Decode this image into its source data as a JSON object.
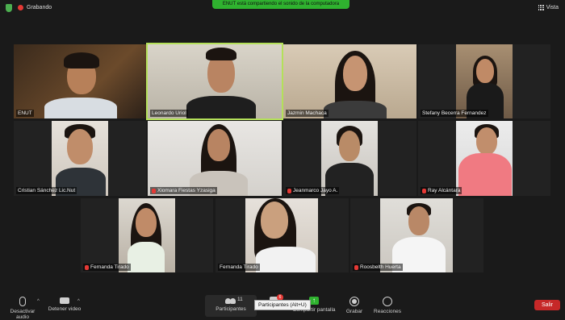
{
  "top": {
    "recording_label": "Grabando",
    "share_banner": "ENUT está compartiendo el sonido de la computadora",
    "view_label": "Vista"
  },
  "participants": [
    {
      "name": "ENUT",
      "muted": false
    },
    {
      "name": "Leonardo Uriol",
      "muted": false
    },
    {
      "name": "Jazmin Machaca",
      "muted": false
    },
    {
      "name": "Stefany Becerra Fernandez",
      "muted": false
    },
    {
      "name": "Cristian Sánchez Lic.Nut",
      "muted": false
    },
    {
      "name": "Xiomara Fiestas Yzasiga",
      "muted": true
    },
    {
      "name": "Jeanmarco Jayo A.",
      "muted": true
    },
    {
      "name": "Ray Alcántara",
      "muted": true
    },
    {
      "name": "Fernanda Tirado",
      "muted": true
    },
    {
      "name": "Fernanda Tirado",
      "muted": false
    },
    {
      "name": "Roosbelth Huerta",
      "muted": true
    }
  ],
  "toolbar": {
    "mute_label": "Desactivar audio",
    "video_label": "Detener video",
    "participants_label": "Participantes",
    "participants_count": "11",
    "chat_label": "Chat",
    "chat_badge": "6",
    "share_label": "Compartir pantalla",
    "record_label": "Grabar",
    "reactions_label": "Reacciones",
    "leave_label": "Salir",
    "tooltip": "Participantes (Alt+U)"
  },
  "colors": {
    "active_speaker_border": "#b4e05a",
    "share_green": "#2fb22f",
    "leave_red": "#c62828"
  }
}
